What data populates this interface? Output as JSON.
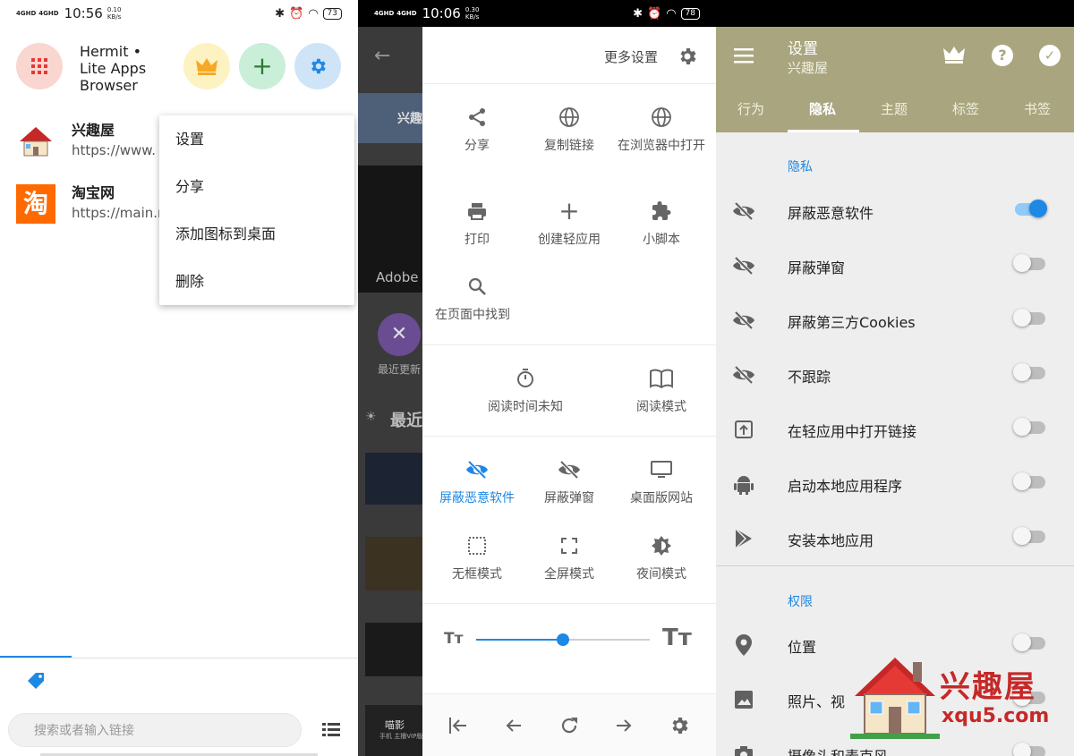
{
  "panel1": {
    "status": {
      "sig1": "4GHD",
      "sig2": "4GHD",
      "time": "10:56",
      "speed_top": "0.10",
      "speed_bottom": "KB/s",
      "battery": "73"
    },
    "app_title": "Hermit • Lite Apps Browser",
    "sites": [
      {
        "name": "兴趣屋",
        "url": "https://www."
      },
      {
        "name": "淘宝网",
        "url": "https://main.r"
      }
    ],
    "favicon_taobao": "淘",
    "menu": [
      "设置",
      "分享",
      "添加图标到桌面",
      "删除"
    ],
    "search_placeholder": "搜索或者输入链接"
  },
  "panel2": {
    "status": {
      "sig1": "4GHD",
      "sig2": "4GHD",
      "time": "10:06",
      "speed_top": "0.30",
      "speed_bottom": "KB/s",
      "battery": "78"
    },
    "background_text": {
      "adobe": "Adobe",
      "recent": "最近更新",
      "zuijin": "最近",
      "xing": "兴趣",
      "yingying": "喵影",
      "yingying_sub": "手机 主播VIP版"
    },
    "more_settings": "更多设置",
    "actions": {
      "share": "分享",
      "copy_link": "复制链接",
      "open_browser": "在浏览器中打开",
      "print": "打印",
      "create_lite": "创建轻应用",
      "scripts": "小脚本",
      "find": "在页面中找到",
      "read_time": "阅读时间未知",
      "read_mode": "阅读模式",
      "block_malware": "屏蔽恶意软件",
      "block_popups": "屏蔽弹窗",
      "desktop_site": "桌面版网站",
      "frameless": "无框模式",
      "fullscreen": "全屏模式",
      "night": "夜间模式"
    },
    "text_size_level": 0.5
  },
  "panel3": {
    "title": "设置",
    "subtitle": "兴趣屋",
    "tabs": [
      "行为",
      "隐私",
      "主题",
      "标签",
      "书签"
    ],
    "active_tab": 1,
    "section_privacy": "隐私",
    "privacy_rows": [
      {
        "label": "屏蔽恶意软件",
        "on": true,
        "icon": "eye-off-icon"
      },
      {
        "label": "屏蔽弹窗",
        "on": false,
        "icon": "eye-off-icon"
      },
      {
        "label": "屏蔽第三方Cookies",
        "on": false,
        "icon": "eye-off-icon"
      },
      {
        "label": "不跟踪",
        "on": false,
        "icon": "eye-off-icon"
      },
      {
        "label": "在轻应用中打开链接",
        "on": false,
        "icon": "open-in-app-icon"
      },
      {
        "label": "启动本地应用程序",
        "on": false,
        "icon": "android-icon"
      },
      {
        "label": "安装本地应用",
        "on": false,
        "icon": "play-store-icon"
      }
    ],
    "section_permissions": "权限",
    "permission_rows": [
      {
        "label": "位置",
        "on": false,
        "icon": "location-icon"
      },
      {
        "label": "照片、视",
        "on": false,
        "icon": "image-icon"
      },
      {
        "label": "摄像头和麦克风",
        "on": false,
        "icon": "camera-icon"
      }
    ],
    "accent": "#1e88e5",
    "toolbar_color": "#a9a57e"
  },
  "watermark": {
    "text1": "兴趣屋",
    "text2": "xqu5.com"
  }
}
